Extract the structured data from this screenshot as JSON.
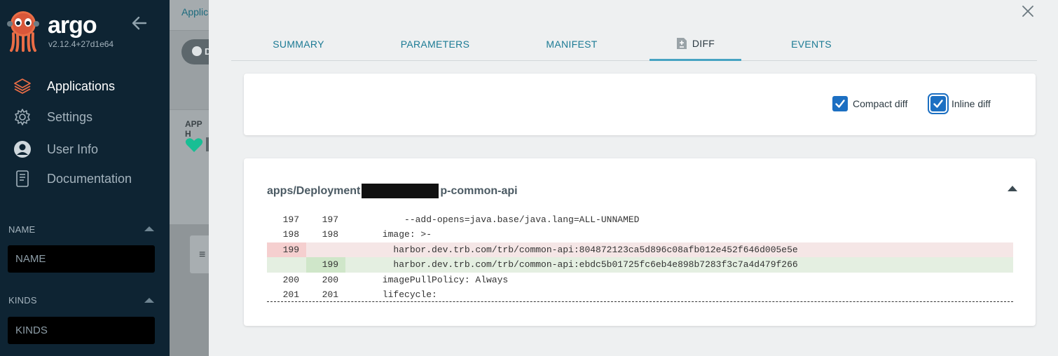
{
  "sidebar": {
    "brand": "argo",
    "version": "v2.12.4+27d1e64",
    "nav": [
      {
        "label": "Applications",
        "icon": "layers-icon"
      },
      {
        "label": "Settings",
        "icon": "gear-icon"
      },
      {
        "label": "User Info",
        "icon": "user-icon"
      },
      {
        "label": "Documentation",
        "icon": "book-icon"
      }
    ],
    "filters": {
      "name_title": "NAME",
      "name_placeholder": "NAME",
      "kinds_title": "KINDS",
      "kinds_placeholder": "KINDS"
    }
  },
  "behind": {
    "crumb": "Applic",
    "pill_text": "D",
    "app_health_label": "APP H"
  },
  "panel": {
    "tabs": [
      "SUMMARY",
      "PARAMETERS",
      "MANIFEST",
      "DIFF",
      "EVENTS"
    ],
    "active_tab": "DIFF",
    "options": {
      "compact_label": "Compact diff",
      "compact_checked": true,
      "inline_label": "Inline diff",
      "inline_checked": true
    },
    "diff": {
      "title_prefix": "apps/Deployment",
      "title_suffix": "p-common-api",
      "lines": [
        {
          "old": "197",
          "new": "197",
          "code": "          --add-opens=java.base/java.lang=ALL-UNNAMED",
          "type": "ctx"
        },
        {
          "old": "198",
          "new": "198",
          "code": "      image: >-",
          "type": "ctx"
        },
        {
          "old": "199",
          "new": "",
          "code": "        harbor.dev.trb.com/trb/common-api:804872123ca5d896c08afb012e452f646d005e5e",
          "type": "del"
        },
        {
          "old": "",
          "new": "199",
          "code": "        harbor.dev.trb.com/trb/common-api:ebdc5b01725fc6eb4e898b7283f3c7a4d479f266",
          "type": "add"
        },
        {
          "old": "200",
          "new": "200",
          "code": "      imagePullPolicy: Always",
          "type": "ctx"
        },
        {
          "old": "201",
          "new": "201",
          "code": "      lifecycle:",
          "type": "ctx"
        }
      ]
    }
  },
  "colors": {
    "sidebar_bg": "#0e2433",
    "accent_blue": "#1c6fc2",
    "tab_text": "#1b7a94",
    "del_bg": "#f5e6e6",
    "add_bg": "#e4efe1"
  }
}
